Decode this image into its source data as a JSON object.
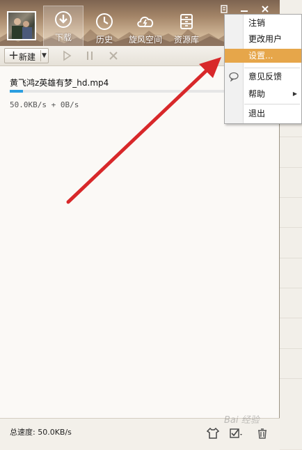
{
  "tabs": [
    {
      "label": "下载",
      "icon": "download-icon",
      "active": true
    },
    {
      "label": "历史",
      "icon": "history-clock-icon",
      "active": false
    },
    {
      "label": "旋风空间",
      "icon": "cloud-space-icon",
      "active": false
    },
    {
      "label": "资源库",
      "icon": "resource-cabinet-icon",
      "active": false
    }
  ],
  "toolbar": {
    "new_label": "新建"
  },
  "task": {
    "filename": "黄飞鸿z英雄有梦_hd.mp4",
    "speed": "50.0KB/s + 0B/s",
    "progress": 0.05
  },
  "status": {
    "total_speed": "总速度: 50.0KB/s"
  },
  "menu": {
    "items": [
      {
        "label": "注销"
      },
      {
        "label": "更改用户"
      },
      {
        "label": "设置..."
      },
      {
        "label": "意见反馈"
      },
      {
        "label": "帮助"
      },
      {
        "label": "退出"
      }
    ]
  },
  "watermark": "Bai 经验",
  "colors": {
    "highlight": "#e6a64a",
    "progress": "#2a9ee0",
    "arrow": "#d8282a"
  }
}
